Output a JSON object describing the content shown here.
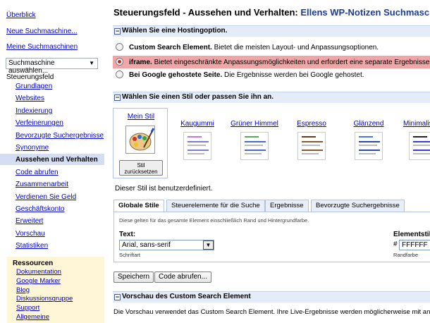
{
  "sidebar": {
    "overview": "Überblick",
    "new_engine": "Neue Suchmaschine...",
    "my_engines": "Meine Suchmaschinen",
    "engine_select": "Suchmaschine auswählen...",
    "control_panel": "Steuerungsfeld",
    "nav": [
      "Grundlagen",
      "Websites",
      "Indexierung",
      "Verfeinerungen",
      "Bevorzugte Suchergebnisse",
      "Synonyme",
      "Aussehen und Verhalten",
      "Code abrufen",
      "Zusammenarbeit",
      "Verdienen Sie Geld",
      "Geschäftskonto",
      "Erweitert",
      "Vorschau",
      "Statistiken"
    ],
    "resources_title": "Ressourcen",
    "resources": [
      "Dokumentation",
      "Google Marker",
      "Blog",
      "Diskussionsgruppe",
      "Support",
      "Allgemeine"
    ]
  },
  "header": {
    "title_prefix": "Steuerungsfeld - Aussehen und Verhalten:",
    "engine_name": "Ellens WP-Notizen Suchmaschine"
  },
  "hosting": {
    "section_title": "Wählen Sie eine Hostingoption.",
    "options": [
      {
        "label": "Custom Search Element.",
        "desc": "Bietet die meisten Layout- und Anpassungsoptionen."
      },
      {
        "label": "iframe.",
        "desc": "Bietet eingeschränkte Anpassungsmöglichkeiten und erfordert eine separate Ergebnisseite au"
      },
      {
        "label": "Bei Google gehostete Seite.",
        "desc": "Die Ergebnisse werden bei Google gehostet."
      }
    ],
    "selected_index": 1
  },
  "styles": {
    "section_title": "Wählen Sie einen Stil oder passen Sie ihn an.",
    "my_style": "Mein Stil",
    "reset_label": "Stil zurücksetzen",
    "presets": [
      "Kaugummi",
      "Grüner Himmel",
      "Espresso",
      "Glänzend",
      "Minimalis"
    ],
    "custom_note": "Dieser Stil ist benutzerdefiniert."
  },
  "tabs": {
    "items": [
      "Globale Stile",
      "Steuerelemente für die Suche",
      "Ergebnisse",
      "Bevorzugte Suchergebnisse"
    ],
    "active_index": 0,
    "panel_note": "Diese gelten für das gesamte Element einschließlich Rand und Hintergrundfarbe.",
    "text_label": "Text:",
    "font_value": "Arial, sans-serif",
    "font_caption": "Schriftart",
    "border_label": "Elementstil:",
    "border_hash": "#",
    "border_value": "FFFFFF",
    "border_caption": "Randfarbe"
  },
  "actions": {
    "save": "Speichern",
    "get_code": "Code abrufen..."
  },
  "preview": {
    "section_title": "Vorschau des Custom Search Element",
    "text": "Die Vorschau verwendet das Custom Search Element. Ihre Live-Ergebnisse werden möglicherweise mit ande"
  },
  "colors": {
    "link": "#0000cc",
    "highlight": "#f0a6a6",
    "section_bar": "#e5ecf9",
    "active_nav": "#d5ddf3",
    "resources_bg": "#fff6d8"
  }
}
